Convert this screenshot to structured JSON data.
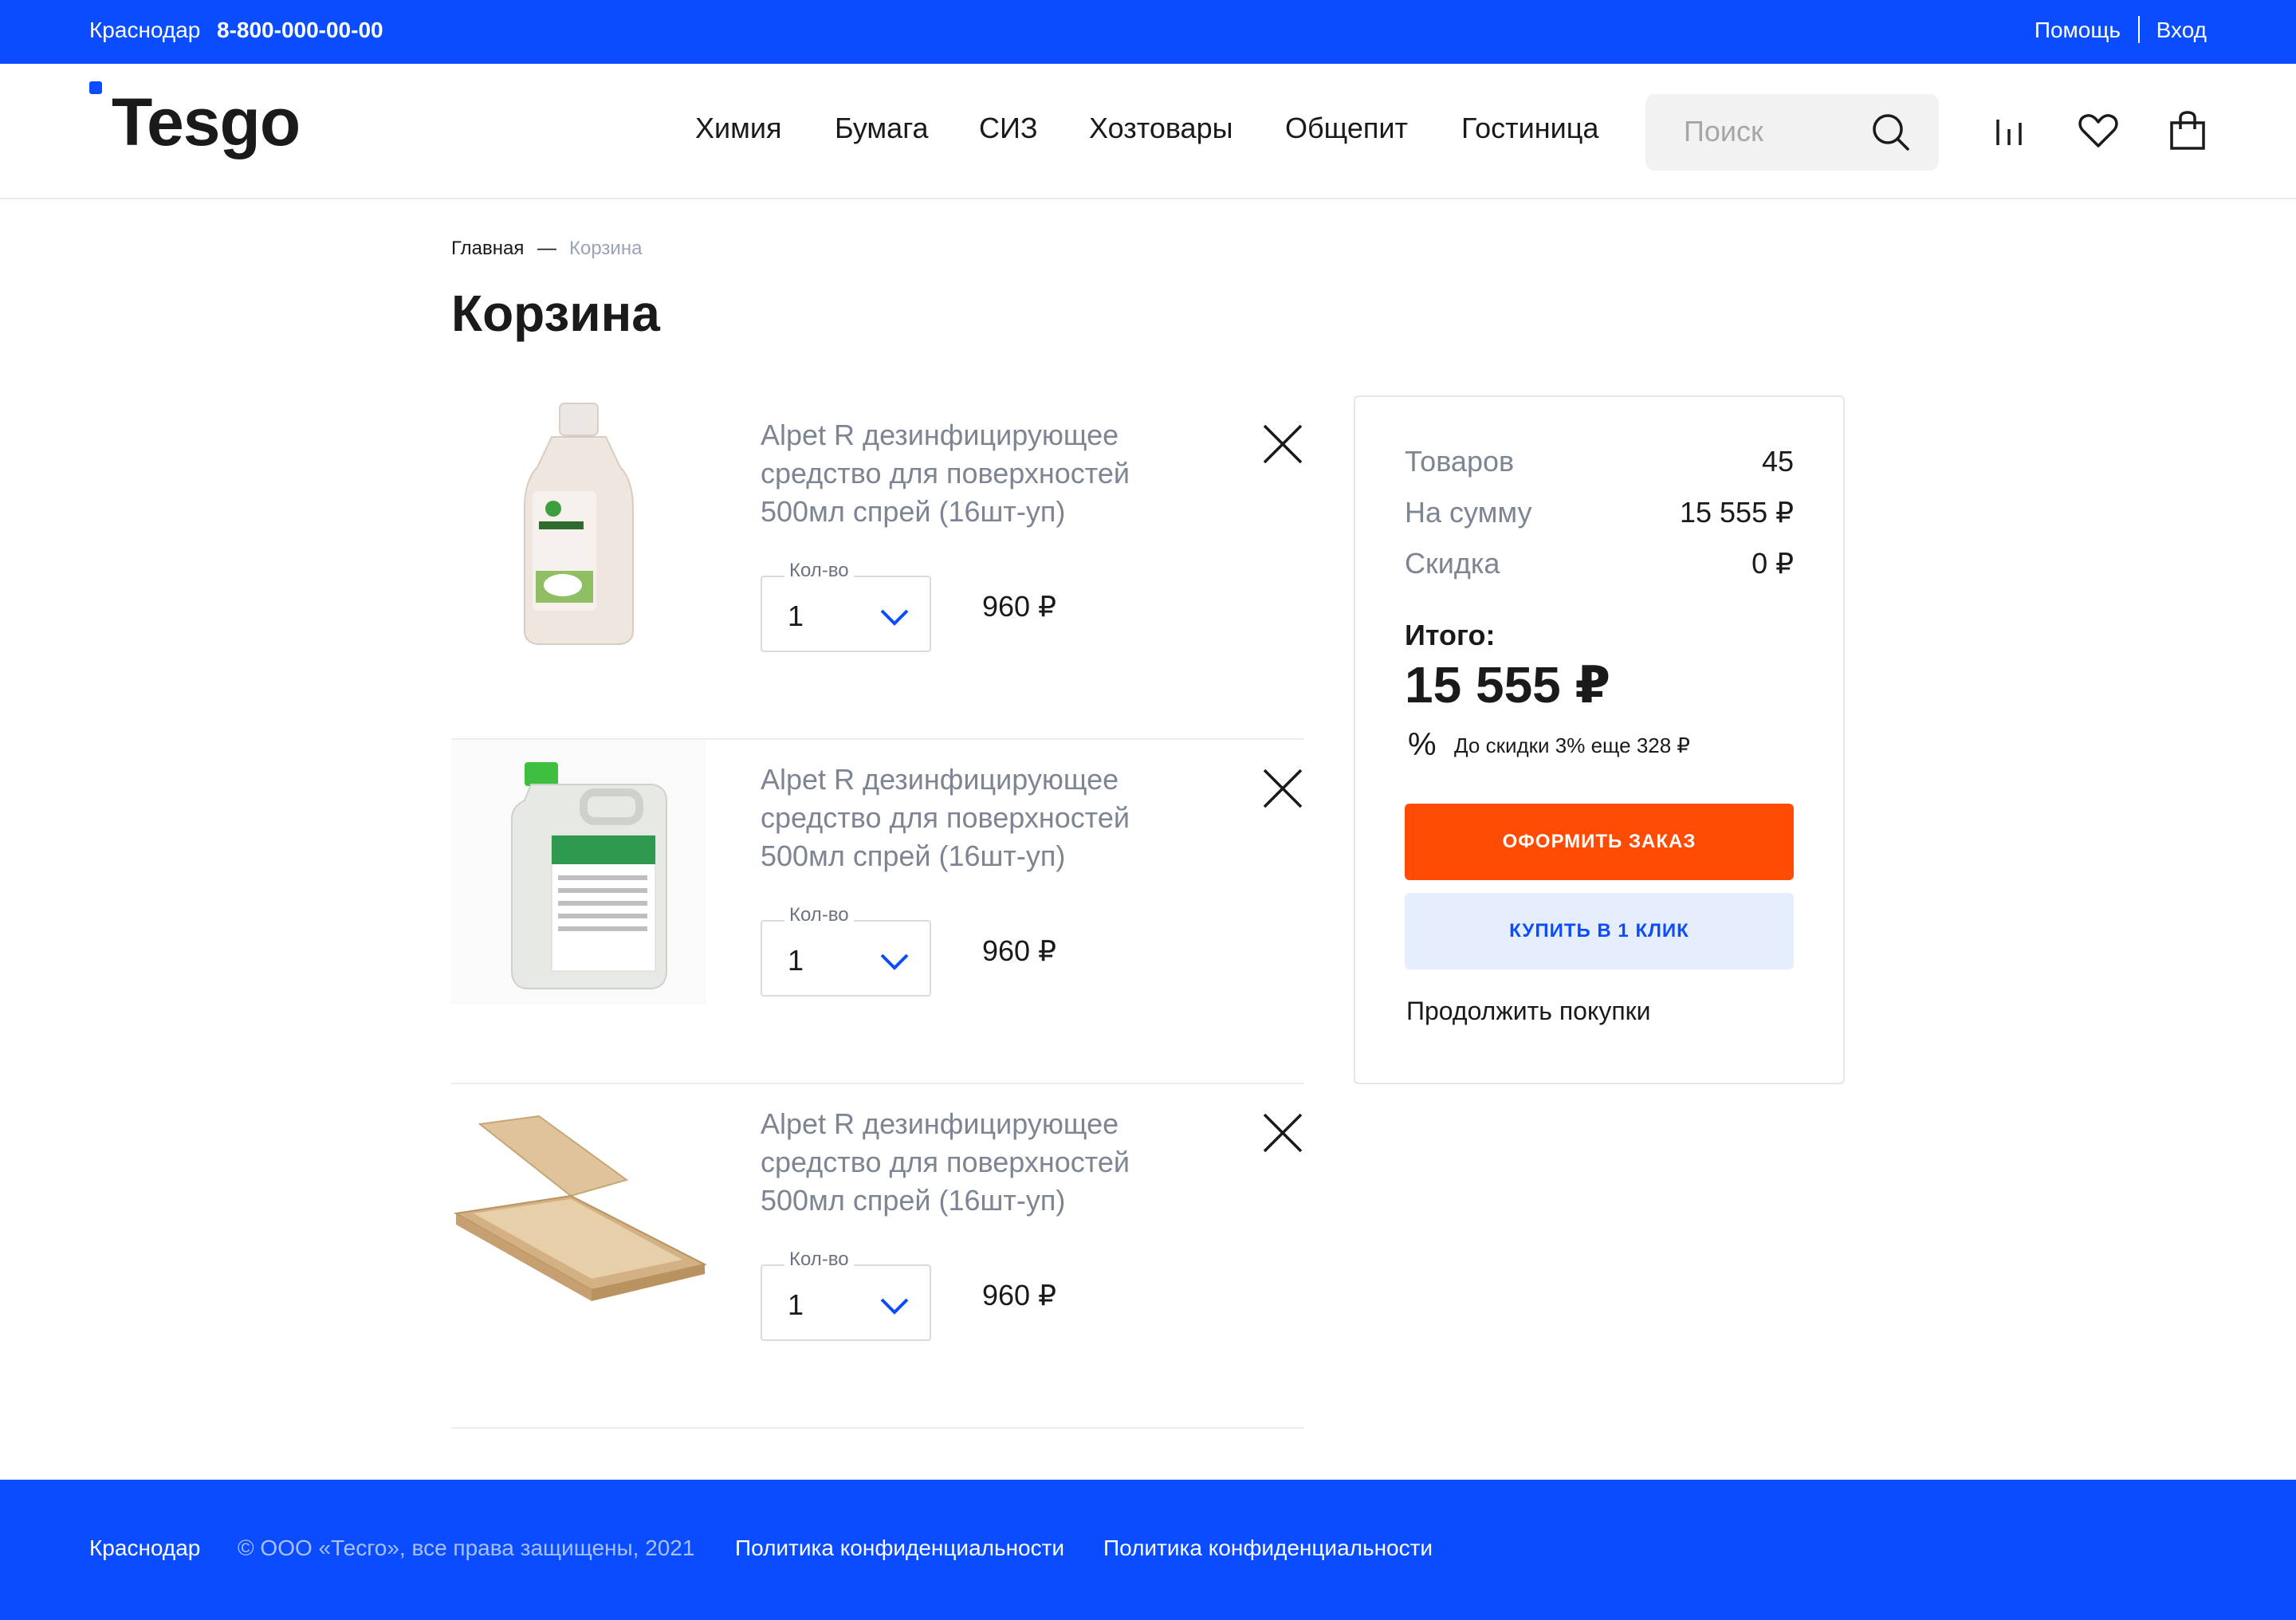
{
  "topbar": {
    "city": "Краснодар",
    "phone": "8-800-000-00-00",
    "help": "Помощь",
    "login": "Вход"
  },
  "header": {
    "logo": "Tesgo",
    "nav": [
      "Химия",
      "Бумага",
      "СИЗ",
      "Хозтовары",
      "Общепит",
      "Гостиница"
    ],
    "search_placeholder": "Поиск",
    "icons": [
      "compare-icon",
      "heart-icon",
      "shopping-bag-icon"
    ]
  },
  "breadcrumb": {
    "home": "Главная",
    "separator": "—",
    "current": "Корзина"
  },
  "page_title": "Корзина",
  "cart": {
    "qty_label": "Кол-во",
    "items": [
      {
        "title": "Alpet R дезинфицирующее средство для поверхностей 500мл спрей (16шт-уп)",
        "qty": "1",
        "price": "960 ₽",
        "image": "white-bottle"
      },
      {
        "title": "Alpet R дезинфицирующее средство для поверхностей 500мл спрей (16шт-уп)",
        "qty": "1",
        "price": "960 ₽",
        "image": "canister"
      },
      {
        "title": "Alpet R дезинфицирующее средство для поверхностей 500мл спрей (16шт-уп)",
        "qty": "1",
        "price": "960 ₽",
        "image": "pizza-box"
      }
    ]
  },
  "summary": {
    "items_label": "Товаров",
    "items_value": "45",
    "sum_label": "На сумму",
    "sum_value": "15 555 ₽",
    "discount_label": "Скидка",
    "discount_value": "0 ₽",
    "total_label": "Итого:",
    "total_value": "15 555 ₽",
    "discount_hint_icon": "%",
    "discount_hint": "До скидки 3% еще 328 ₽",
    "order_button": "ОФОРМИТЬ ЗАКАЗ",
    "one_click_button": "КУПИТЬ В 1 КЛИК",
    "continue_link": "Продолжить покупки"
  },
  "footer": {
    "city": "Краснодар",
    "copyright": "© ООО «Тесго», все права защищены, 2021",
    "links": [
      "Политика конфиденциальности",
      "Политика конфиденциальности"
    ]
  },
  "colors": {
    "brand_blue": "#0a4cff",
    "order_orange": "#ff4c05",
    "one_click_bg": "#e6eefe",
    "muted_text": "#7d8593"
  }
}
